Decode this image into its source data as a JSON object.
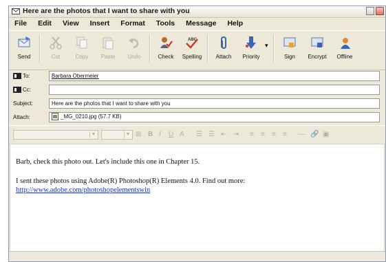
{
  "window": {
    "title": "Here are the photos that I want to share with you"
  },
  "menu": [
    "File",
    "Edit",
    "View",
    "Insert",
    "Format",
    "Tools",
    "Message",
    "Help"
  ],
  "toolbar": {
    "send": "Send",
    "cut": "Cut",
    "copy": "Copy",
    "paste": "Paste",
    "undo": "Undo",
    "check": "Check",
    "spelling": "Spelling",
    "attach": "Attach",
    "priority": "Priority",
    "sign": "Sign",
    "encrypt": "Encrypt",
    "offline": "Offline"
  },
  "headers": {
    "to_label": "To:",
    "to_value": "Barbara Obermeier",
    "cc_label": "Cc:",
    "cc_value": "",
    "subject_label": "Subject:",
    "subject_value": "Here are the photos that I want to share with you",
    "attach_label": "Attach:",
    "attach_value": "_MG_0210.jpg (57.7 KB)"
  },
  "message": {
    "line1": "Barb, check this photo out. Let's include this one in Chapter 15.",
    "line2": "I sent these photos using Adobe(R) Photoshop(R) Elements 4.0. Find out more:",
    "link": "http://www.adobe.com/photoshopelementswin"
  },
  "colors": {
    "link": "#1a35c0",
    "chrome": "#ECE9D8"
  }
}
